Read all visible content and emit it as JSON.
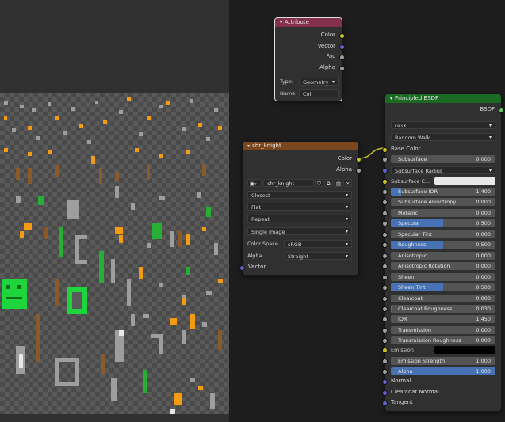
{
  "attribute_node": {
    "title": "Attribute",
    "outputs": [
      "Color",
      "Vector",
      "Fac",
      "Alpha"
    ],
    "type_label": "Type:",
    "type_value": "Geometry",
    "name_label": "Name:",
    "name_value": "Col"
  },
  "image_node": {
    "title": "chr_knight",
    "outputs": [
      "Color",
      "Alpha"
    ],
    "image_name": "chr_knight",
    "interpolation": "Closest",
    "projection": "Flat",
    "extension": "Repeat",
    "source": "Single Image",
    "color_space_label": "Color Space",
    "color_space_value": "sRGB",
    "alpha_label": "Alpha",
    "alpha_value": "Straight",
    "vector_input": "Vector"
  },
  "bsdf_node": {
    "title": "Principled BSDF",
    "output": "BSDF",
    "distribution": "GGX",
    "subsurface_method": "Random Walk",
    "base_color_label": "Base Color",
    "subsurface": {
      "label": "Subsurface",
      "value": "0.000"
    },
    "subsurface_radius": "Subsurface Radius",
    "subsurface_color_label": "Subsurface C...",
    "fields": [
      {
        "label": "Subsurface IOR",
        "value": "1.400",
        "fill": 0.1
      },
      {
        "label": "Subsurface Anisotropy",
        "value": "0.000",
        "fill": 0
      },
      {
        "label": "Metallic",
        "value": "0.000",
        "fill": 0
      },
      {
        "label": "Specular",
        "value": "0.500",
        "fill": 0.5
      },
      {
        "label": "Specular Tint",
        "value": "0.000",
        "fill": 0
      },
      {
        "label": "Roughness",
        "value": "0.500",
        "fill": 0.5
      },
      {
        "label": "Anisotropic",
        "value": "0.000",
        "fill": 0
      },
      {
        "label": "Anisotropic Rotation",
        "value": "0.000",
        "fill": 0
      },
      {
        "label": "Sheen",
        "value": "0.000",
        "fill": 0
      },
      {
        "label": "Sheen Tint",
        "value": "0.500",
        "fill": 0.5
      },
      {
        "label": "Clearcoat",
        "value": "0.000",
        "fill": 0
      },
      {
        "label": "Clearcoat Roughness",
        "value": "0.030",
        "fill": 0.03
      },
      {
        "label": "IOR",
        "value": "1.450",
        "fill": 0
      },
      {
        "label": "Transmission",
        "value": "0.000",
        "fill": 0
      },
      {
        "label": "Transmission Roughness",
        "value": "0.000",
        "fill": 0
      }
    ],
    "emission_label": "Emission",
    "emission_strength": {
      "label": "Emission Strength",
      "value": "1.000",
      "fill": 0
    },
    "alpha": {
      "label": "Alpha",
      "value": "1.000",
      "fill": 1
    },
    "vector_inputs": [
      "Normal",
      "Clearcoat Normal",
      "Tangent"
    ]
  },
  "colors": {
    "attribute_header": "#83314a",
    "texture_header": "#79461d",
    "shader_header": "#1b6a24",
    "link": "#c7c729",
    "field_fill": "#4772b3"
  }
}
